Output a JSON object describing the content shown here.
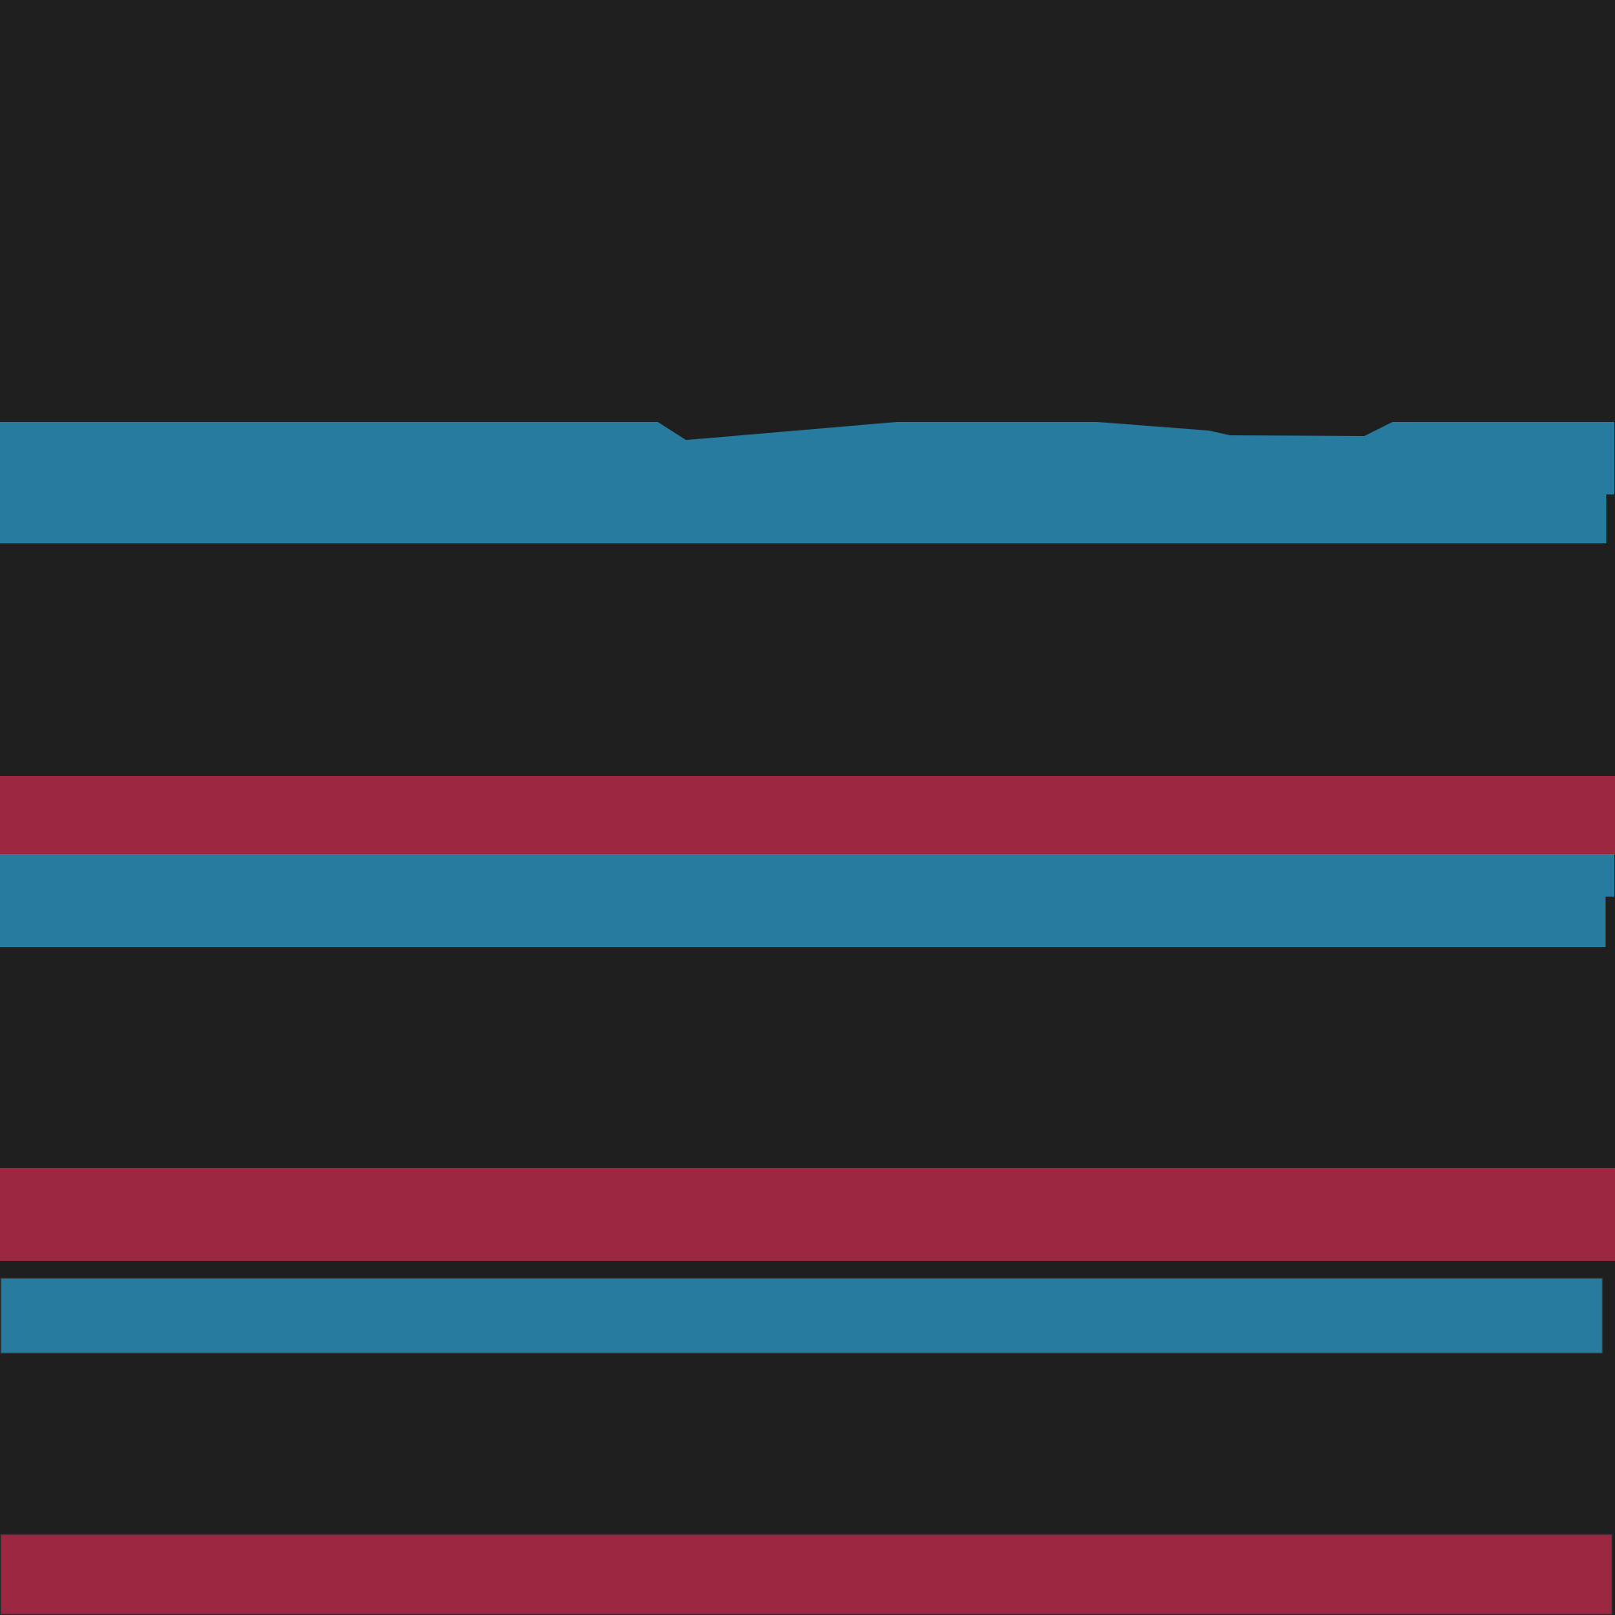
{
  "background_color": "#1f1f1f",
  "bands": [
    {
      "name": "blue-band-1",
      "color": "#277b9e"
    },
    {
      "name": "red-band-1",
      "color": "#9b2741"
    },
    {
      "name": "blue-band-2",
      "color": "#277b9e"
    },
    {
      "name": "red-band-2",
      "color": "#9b2741"
    },
    {
      "name": "blue-band-3",
      "color": "#277b9e"
    },
    {
      "name": "red-band-3",
      "color": "#9b2741"
    }
  ]
}
